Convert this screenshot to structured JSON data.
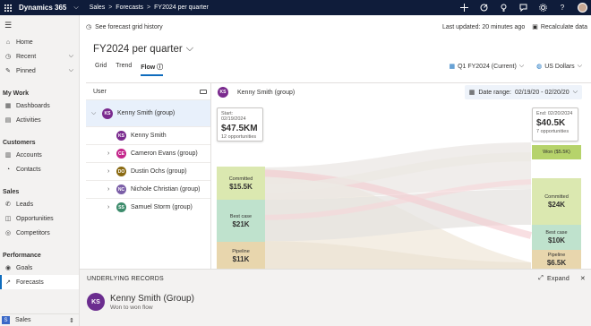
{
  "topbar": {
    "app_name": "Dynamics 365",
    "breadcrumb": [
      "Sales",
      "Forecasts",
      "FY2024 per quarter"
    ],
    "icons": [
      "plus-icon",
      "target-icon",
      "lightbulb-icon",
      "assistant-icon",
      "gear-icon",
      "help-icon",
      "user-avatar"
    ]
  },
  "nav": {
    "home": "Home",
    "recent": "Recent",
    "pinned": "Pinned",
    "groups": [
      {
        "title": "My Work",
        "items": [
          "Dashboards",
          "Activities"
        ]
      },
      {
        "title": "Customers",
        "items": [
          "Accounts",
          "Contacts"
        ]
      },
      {
        "title": "Sales",
        "items": [
          "Leads",
          "Opportunities",
          "Competitors"
        ]
      },
      {
        "title": "Performance",
        "items": [
          "Goals",
          "Forecasts"
        ]
      }
    ],
    "area": {
      "letter": "S",
      "label": "Sales"
    }
  },
  "cmdbar": {
    "history": "See forecast grid history",
    "last_updated": "Last updated: 20 minutes ago",
    "recalculate": "Recalculate data"
  },
  "page": {
    "title": "FY2024 per quarter",
    "tabs": [
      "Grid",
      "Trend",
      "Flow"
    ],
    "active_tab": "Flow",
    "period": "Q1 FY2024 (Current)",
    "currency": "US Dollars"
  },
  "tree": {
    "header": "User",
    "root": {
      "initials": "KS",
      "name": "Kenny Smith (group)",
      "color": "#7a2a8e"
    },
    "children": [
      {
        "initials": "KS",
        "name": "Kenny Smith",
        "color": "#7a2a8e",
        "expandable": false
      },
      {
        "initials": "CE",
        "name": "Cameron Evans (group)",
        "color": "#c4268b",
        "expandable": true
      },
      {
        "initials": "DO",
        "name": "Dustin Ochs (group)",
        "color": "#8a6a12",
        "expandable": true
      },
      {
        "initials": "NC",
        "name": "Nichole Christian  (group)",
        "color": "#7b5ea7",
        "expandable": true
      },
      {
        "initials": "SS",
        "name": "Samuel Storm  (group)",
        "color": "#3d8c6c",
        "expandable": true
      }
    ]
  },
  "flow": {
    "header_initials": "KS",
    "header_name": "Kenny Smith (group)",
    "date_label": "Date range:",
    "date_value": "02/19/20 - 02/20/20",
    "start": {
      "label": "Start: 02/19/2024",
      "amount": "$47.5KM",
      "opps": "12 opportunities"
    },
    "end": {
      "label": "End: 02/20/2024",
      "amount": "$40.5K",
      "opps": "7 opportunities"
    },
    "won": "Won ($5.5K)",
    "left_blocks": [
      {
        "name": "Committed",
        "value": "$15.5K",
        "color": "#dbe8b0"
      },
      {
        "name": "Best case",
        "value": "$21K",
        "color": "#bfe2cd"
      },
      {
        "name": "Pipeline",
        "value": "$11K",
        "color": "#e8d6ad"
      }
    ],
    "right_blocks": [
      {
        "name": "Committed",
        "value": "$24K",
        "color": "#dbe8b0"
      },
      {
        "name": "Best case",
        "value": "$10K",
        "color": "#bfe2cd"
      },
      {
        "name": "Pipeline",
        "value": "$6.5K",
        "color": "#e8d6ad"
      }
    ]
  },
  "records": {
    "header": "UNDERLYING RECORDS",
    "expand": "Expand",
    "initials": "KS",
    "name": "Kenny Smith (Group)",
    "subtitle": "Won to won flow"
  }
}
